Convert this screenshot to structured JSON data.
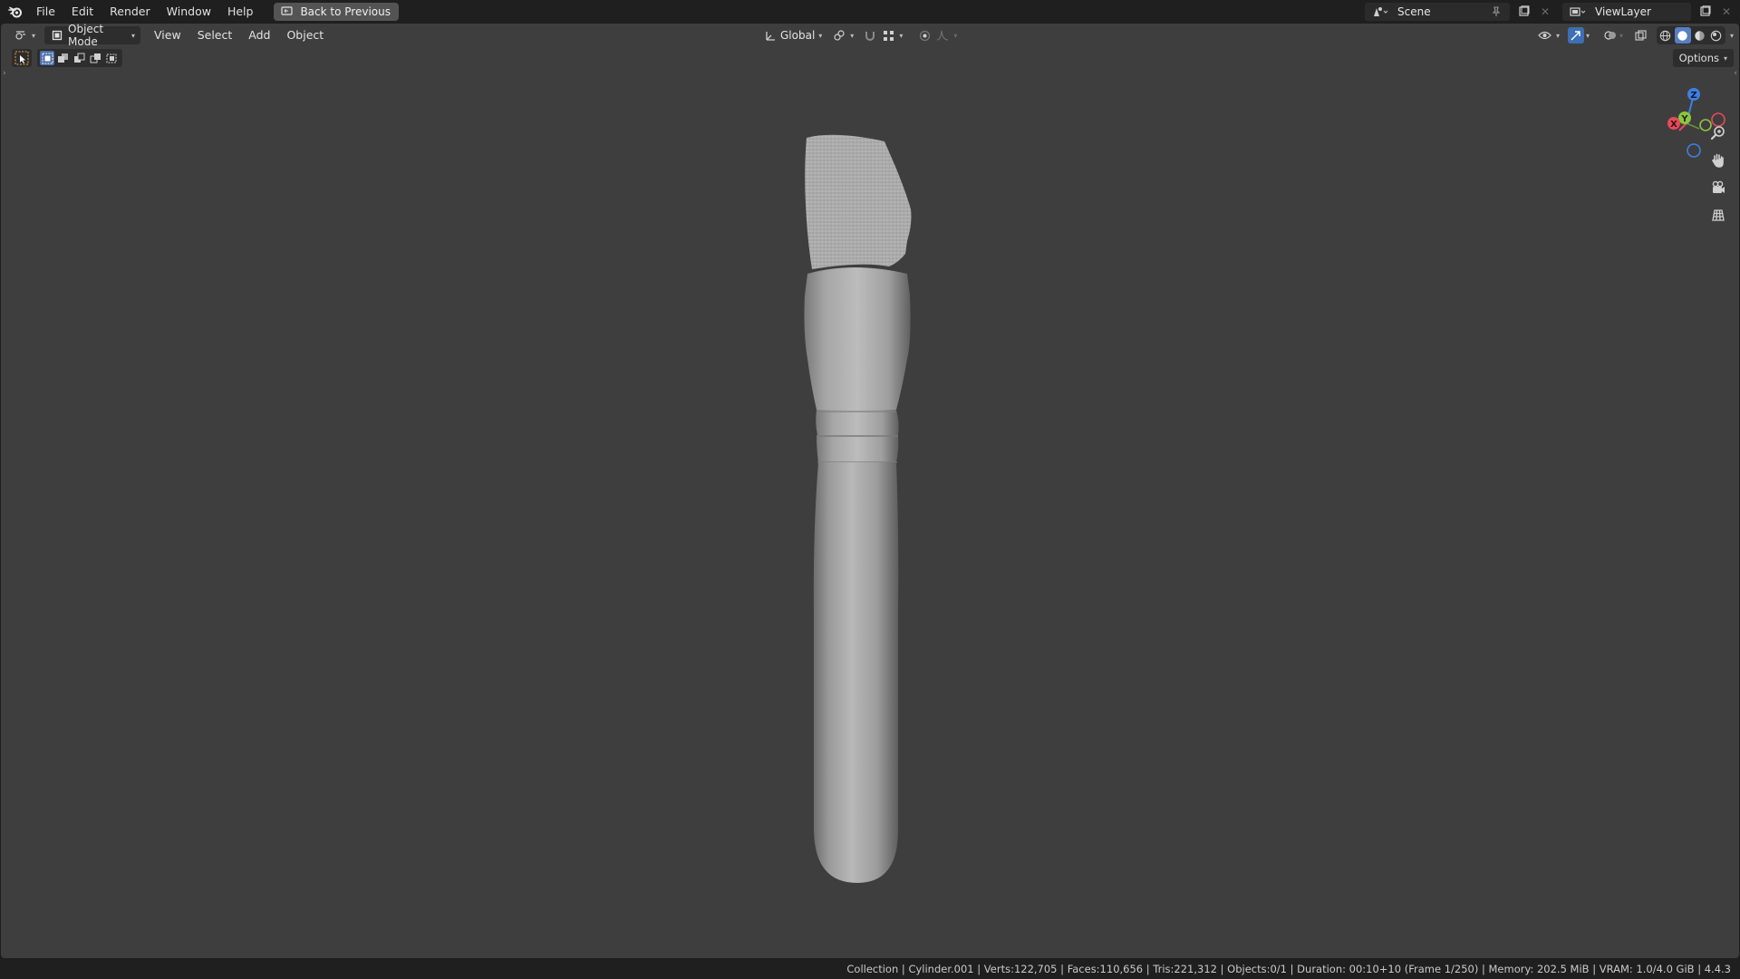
{
  "topbar": {
    "menus": [
      "File",
      "Edit",
      "Render",
      "Window",
      "Help"
    ],
    "back_button": "Back to Previous",
    "scene_name": "Scene",
    "view_layer": "ViewLayer"
  },
  "viewport_header": {
    "mode": "Object Mode",
    "menus": [
      "View",
      "Select",
      "Add",
      "Object"
    ],
    "transform_orientation": "Global",
    "options_label": "Options"
  },
  "gizmo": {
    "axes": {
      "x": "X",
      "y": "Y",
      "z": "Z"
    },
    "colors": {
      "x": "#e54b5b",
      "y": "#8cc63f",
      "z": "#3f7fe0"
    }
  },
  "statusbar": {
    "text": "Collection | Cylinder.001 | Verts:122,705 | Faces:110,656 | Tris:221,312 | Objects:0/1 | Duration: 00:10+10 (Frame 1/250) | Memory: 202.5 MiB | VRAM: 1.0/4.0 GiB | 4.4.3"
  },
  "icons": [
    "blender-logo",
    "editor-type-icon",
    "object-mode-icon",
    "transform-orientation-icon",
    "pivot-icon",
    "snap-icon",
    "proportional-edit-icon",
    "visibility-icon",
    "gizmo-toggle-icon",
    "overlay-icon",
    "xray-icon",
    "wireframe-shading-icon",
    "solid-shading-icon",
    "material-shading-icon",
    "rendered-shading-icon",
    "zoom-icon",
    "pan-hand-icon",
    "camera-view-icon",
    "ortho-grid-icon"
  ]
}
